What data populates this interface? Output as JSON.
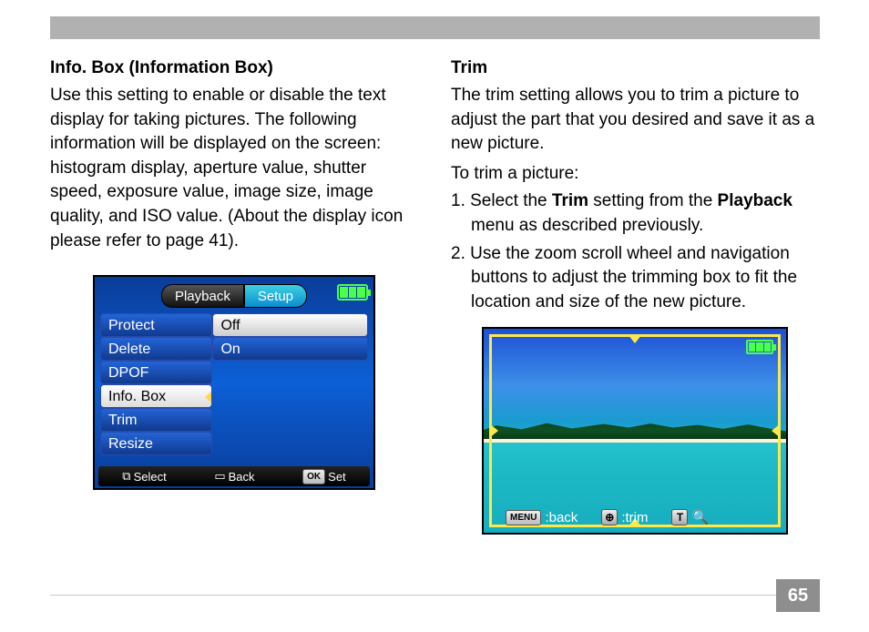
{
  "pageNumber": "65",
  "left": {
    "heading": "Info. Box (Information Box)",
    "para": "Use this setting to enable or disable the text display for taking pictures. The following information will be displayed on the screen: histogram display, aperture value, shutter speed, exposure value, image size, image quality, and ISO value. (About the display icon please refer to page 41)."
  },
  "right": {
    "heading": "Trim",
    "para": "The trim setting allows you to trim a picture to adjust the part that you desired and save it as a new picture.",
    "sub": "To trim a picture:",
    "step1_pre": "1. Select the ",
    "step1_bold1": "Trim",
    "step1_mid": " setting from the ",
    "step1_bold2": "Playback",
    "step1_post": " menu as described previously.",
    "step2": "2. Use the zoom scroll wheel and navigation buttons to adjust the trimming box to fit the location and size of the new picture."
  },
  "camMenu": {
    "tabPlayback": "Playback",
    "tabSetup": "Setup",
    "leftItems": [
      "Protect",
      "Delete",
      "DPOF",
      "Info. Box",
      "Trim",
      "Resize"
    ],
    "rightItems": [
      "Off",
      "On"
    ],
    "selectedLeftIndex": 3,
    "selectedRightIndex": 0,
    "footerSelect": "Select",
    "footerBack": "Back",
    "footerSet": "Set",
    "footerOK": "OK"
  },
  "trim": {
    "back": ":back",
    "trim": ":trim",
    "menu": "MENU",
    "tMark": "T"
  }
}
